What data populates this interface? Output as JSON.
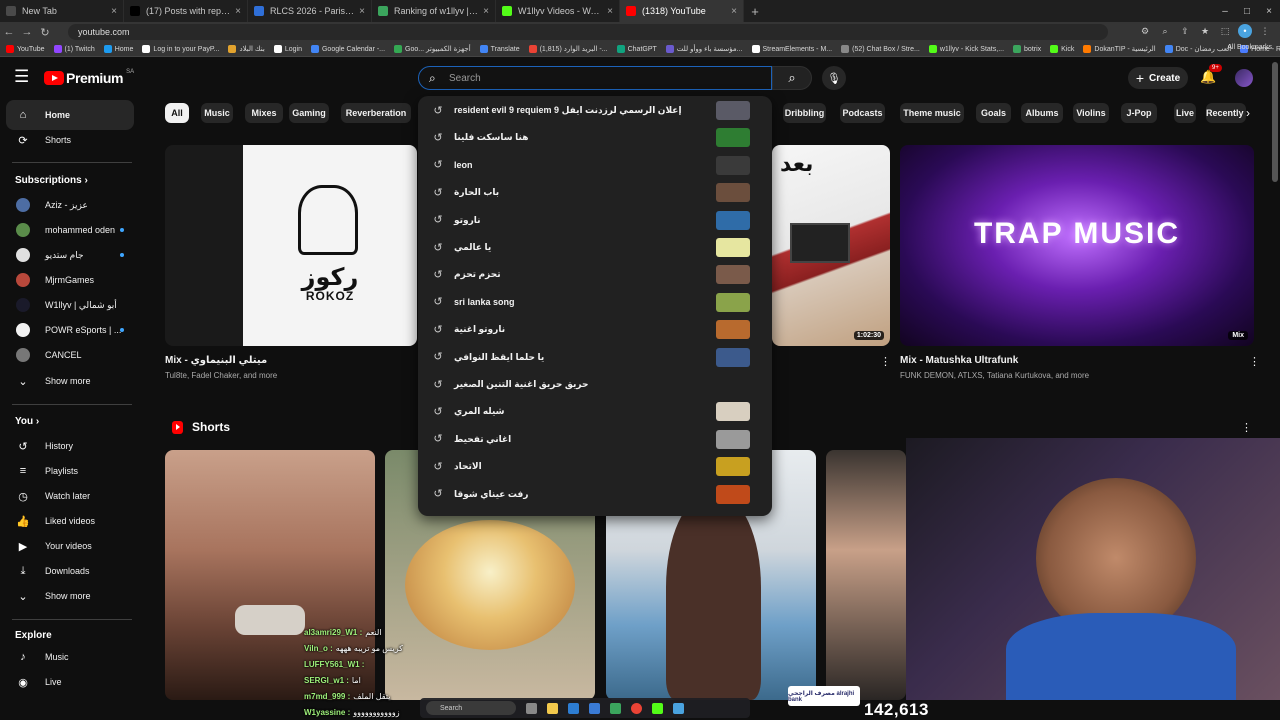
{
  "browser": {
    "tabs": [
      {
        "title": "New Tab",
        "color": "#4a4a4a",
        "active": false
      },
      {
        "title": "(17) Posts with replies by رزيلي",
        "color": "#000000",
        "active": false
      },
      {
        "title": "RLCS 2026 - Paris Major: Midd",
        "color": "#2f6fd8",
        "active": false
      },
      {
        "title": "Ranking of w1llyv | BotRix — C",
        "color": "#3ba55d",
        "active": false
      },
      {
        "title": "W1llyv Videos - Watch On-Dem",
        "color": "#53fc18",
        "active": false
      },
      {
        "title": "(1318) YouTube",
        "color": "#ff0000",
        "active": true
      }
    ],
    "new_tab": "+",
    "url": "youtube.com",
    "bookmarks": [
      {
        "label": "YouTube",
        "color": "#ff0000"
      },
      {
        "label": "(1) Twitch",
        "color": "#9146ff"
      },
      {
        "label": "Home",
        "color": "#1d9bf0"
      },
      {
        "label": "Log in to your PayP...",
        "color": "#ffffff"
      },
      {
        "label": "بنك البلاد",
        "color": "#e2a32e"
      },
      {
        "label": "Login",
        "color": "#ffffff"
      },
      {
        "label": "Google Calendar -...",
        "color": "#4285f4"
      },
      {
        "label": "Goo... أجهزة الكمبيوتر",
        "color": "#34a853"
      },
      {
        "label": "Translate",
        "color": "#4285f4"
      },
      {
        "label": "(1,815) البريد الوارد -...",
        "color": "#ea4335"
      },
      {
        "label": "ChatGPT",
        "color": "#10a37f"
      },
      {
        "label": "مؤسسة باء ووأو للت...",
        "color": "#6a5acd"
      },
      {
        "label": "StreamElements - M...",
        "color": "#ffffff"
      },
      {
        "label": "(52) Chat Box / Stre...",
        "color": "#888888"
      },
      {
        "label": "w1llyv - Kick Stats,...",
        "color": "#53fc18"
      },
      {
        "label": "botrix",
        "color": "#3ba55d"
      },
      {
        "label": "Kick",
        "color": "#53fc18"
      },
      {
        "label": "DokanTIP - الرئيسية",
        "color": "#ff7a00"
      },
      {
        "label": "Doc - ألعب رمضان",
        "color": "#4285f4"
      },
      {
        "label": "Home - Restream",
        "color": "#4a7cff"
      }
    ],
    "all_bookmarks": "All Bookmarks"
  },
  "header": {
    "logo_text": "Premium",
    "region": "SA",
    "search_placeholder": "Search",
    "create_label": "Create",
    "notif_count": "9+"
  },
  "sidebar": {
    "main": [
      {
        "label": "Home",
        "icon": "home-icon",
        "glyph": "⌂",
        "active": true
      },
      {
        "label": "Shorts",
        "icon": "shorts-icon",
        "glyph": "⟳",
        "active": false
      }
    ],
    "subscriptions_title": "Subscriptions",
    "subscriptions": [
      {
        "label": "Aziz - عزيز",
        "color": "#4d6da3",
        "dot": false
      },
      {
        "label": "mohammed oden",
        "color": "#5a8c4a",
        "dot": true
      },
      {
        "label": "جام ستديو",
        "color": "#e0e0e0",
        "dot": true
      },
      {
        "label": "MjrmGames",
        "color": "#b8483b",
        "dot": false
      },
      {
        "label": "W1llyv | أبو شمالي",
        "color": "#1a1a2a",
        "dot": false
      },
      {
        "label": "POWR eSports | ...",
        "color": "#f2f2f2",
        "dot": true
      },
      {
        "label": "CANCEL",
        "color": "#777777",
        "dot": false
      }
    ],
    "show_more": "Show more",
    "you_title": "You",
    "you": [
      {
        "label": "History",
        "glyph": "↺",
        "icon": "history-icon"
      },
      {
        "label": "Playlists",
        "glyph": "≡",
        "icon": "playlists-icon"
      },
      {
        "label": "Watch later",
        "glyph": "◷",
        "icon": "watch-later-icon"
      },
      {
        "label": "Liked videos",
        "glyph": "👍",
        "icon": "liked-icon"
      },
      {
        "label": "Your videos",
        "glyph": "▶",
        "icon": "your-videos-icon"
      },
      {
        "label": "Downloads",
        "glyph": "⤓",
        "icon": "downloads-icon"
      }
    ],
    "show_more_2": "Show more",
    "explore_title": "Explore",
    "explore": [
      {
        "label": "Music",
        "glyph": "♪",
        "icon": "music-icon"
      },
      {
        "label": "Live",
        "glyph": "◉",
        "icon": "live-icon"
      }
    ]
  },
  "chips": [
    "All",
    "Music",
    "Mixes",
    "Gaming",
    "Reverberation",
    "Dribbling",
    "Podcasts",
    "Theme music",
    "Goals",
    "Albums",
    "Violins",
    "J-Pop",
    "Live",
    "Recently uploaded"
  ],
  "videos": [
    {
      "title": "Mix - ميتلي البنيماوي",
      "meta": "Tul8te, Fadel Chaker, and more",
      "thumb_text": "ركوز",
      "thumb_sub": "ROKOZ"
    },
    {
      "title": "",
      "meta": "",
      "duration": "1:02:30"
    },
    {
      "title": "Mix - Matushka Ultrafunk",
      "meta": "FUNK DEMON, ATLXS, Tatiana Kurtukova, and more",
      "thumb_text": "TRAP MUSIC",
      "badge": "Mix"
    }
  ],
  "shorts": {
    "title": "Shorts"
  },
  "suggestions": [
    {
      "text": "resident evil 9 requiem إعلان الرسمي لرزدنت ايفل 9",
      "thumb": "#5a5a66"
    },
    {
      "text": "هنا ساسكت فلينا",
      "thumb": "#2e7d32"
    },
    {
      "text": "leon",
      "thumb": "#3a3a3a"
    },
    {
      "text": "باب الحارة",
      "thumb": "#6b4e3d"
    },
    {
      "text": "ناروتو",
      "thumb": "#2f6ca8"
    },
    {
      "text": "يا عالمي",
      "thumb": "#e6e6a0"
    },
    {
      "text": "تحزم تحزم",
      "thumb": "#7a5a4a"
    },
    {
      "text": "sri lanka song",
      "thumb": "#8aa34a"
    },
    {
      "text": "ناروتو اغنية",
      "thumb": "#b86a2e"
    },
    {
      "text": "يا حلما ايقظ النوافي",
      "thumb": "#3c5a8c"
    },
    {
      "text": "حريق حريق اغنية التنين الصغير",
      "thumb": ""
    },
    {
      "text": "شيله المري",
      "thumb": "#d8cfc0"
    },
    {
      "text": "اغاني تفحيط",
      "thumb": "#9a9a9a"
    },
    {
      "text": "الاتحاد",
      "thumb": "#c8a020"
    },
    {
      "text": "رفت عيناي شوقا",
      "thumb": "#c04a1a"
    }
  ],
  "overlay": {
    "chat": [
      {
        "user": "al3amri29_W1 :",
        "msg": "النعم"
      },
      {
        "user": "Viln_o :",
        "msg": "كريس مو تريبه هههه"
      },
      {
        "user": "LUFFY561_W1 :",
        "msg": ""
      },
      {
        "user": "SERGI_w1 :",
        "msg": "اما"
      },
      {
        "user": "m7md_999 :",
        "msg": "يتقل الملف"
      },
      {
        "user": "W1yassine :",
        "msg": "زووووووووووو"
      }
    ],
    "counter": "142,613",
    "bank": "مصرف الراجحي alrajhi bank",
    "taskbar_search": "Search"
  }
}
